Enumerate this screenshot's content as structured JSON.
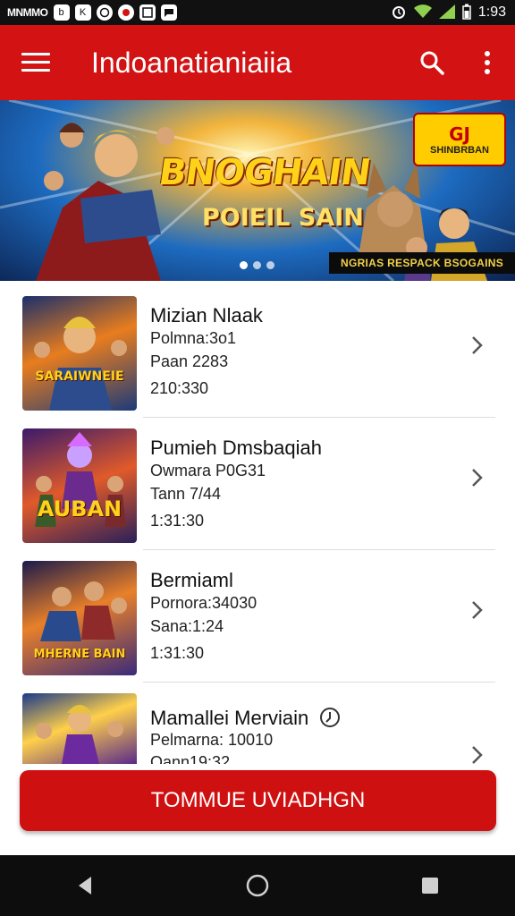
{
  "status_bar": {
    "carrier": "MNMMO",
    "notification_icons": [
      "b-icon",
      "k-icon",
      "whatsapp-icon",
      "record-icon",
      "gallery-icon",
      "message-icon"
    ],
    "time": "1:93",
    "right_icons": [
      "alarm-icon",
      "wifi-icon",
      "signal-icon",
      "battery-icon"
    ]
  },
  "app_bar": {
    "title": "Indoanatianiaiia",
    "icons": [
      "menu-icon",
      "search-icon",
      "more-vertical-icon"
    ],
    "color": "#d31313"
  },
  "banner": {
    "title": "BNOGHAIN",
    "subtitle": "POIEIL SAIN",
    "badge_number": "GJ",
    "badge_text": "SHINBRBAN",
    "caption": "NGRIAS RESPACK BSOGAINS",
    "slide_count": 3,
    "active_slide": 1
  },
  "list": {
    "items": [
      {
        "title": "Mizian Nlaak",
        "line1": "Polmna:3o1",
        "line2": "Paan 2283",
        "line3": "210:330",
        "thumb_label": "SARAIWNEIE"
      },
      {
        "title": "Pumieh Dmsbaqiah",
        "line1": "Owmara P0G31",
        "line2": "Tann 7/44",
        "line3": "1:31:30",
        "thumb_label": "AUBAN"
      },
      {
        "title": "Bermiaml",
        "line1": "Pornora:34030",
        "line2": "Sana:1:24",
        "line3": "1:31:30",
        "thumb_label": "MHERNE BAIN"
      },
      {
        "title": "Mamallei Merviain",
        "line1": "Pelmarna: 10010",
        "line2": "Oann19:32",
        "line3": "",
        "thumb_label": ""
      }
    ]
  },
  "cta": {
    "label": "TOMMUE UVIADHGN"
  },
  "nav_bar": {
    "icons": [
      "back-icon",
      "home-icon",
      "recents-icon"
    ]
  }
}
